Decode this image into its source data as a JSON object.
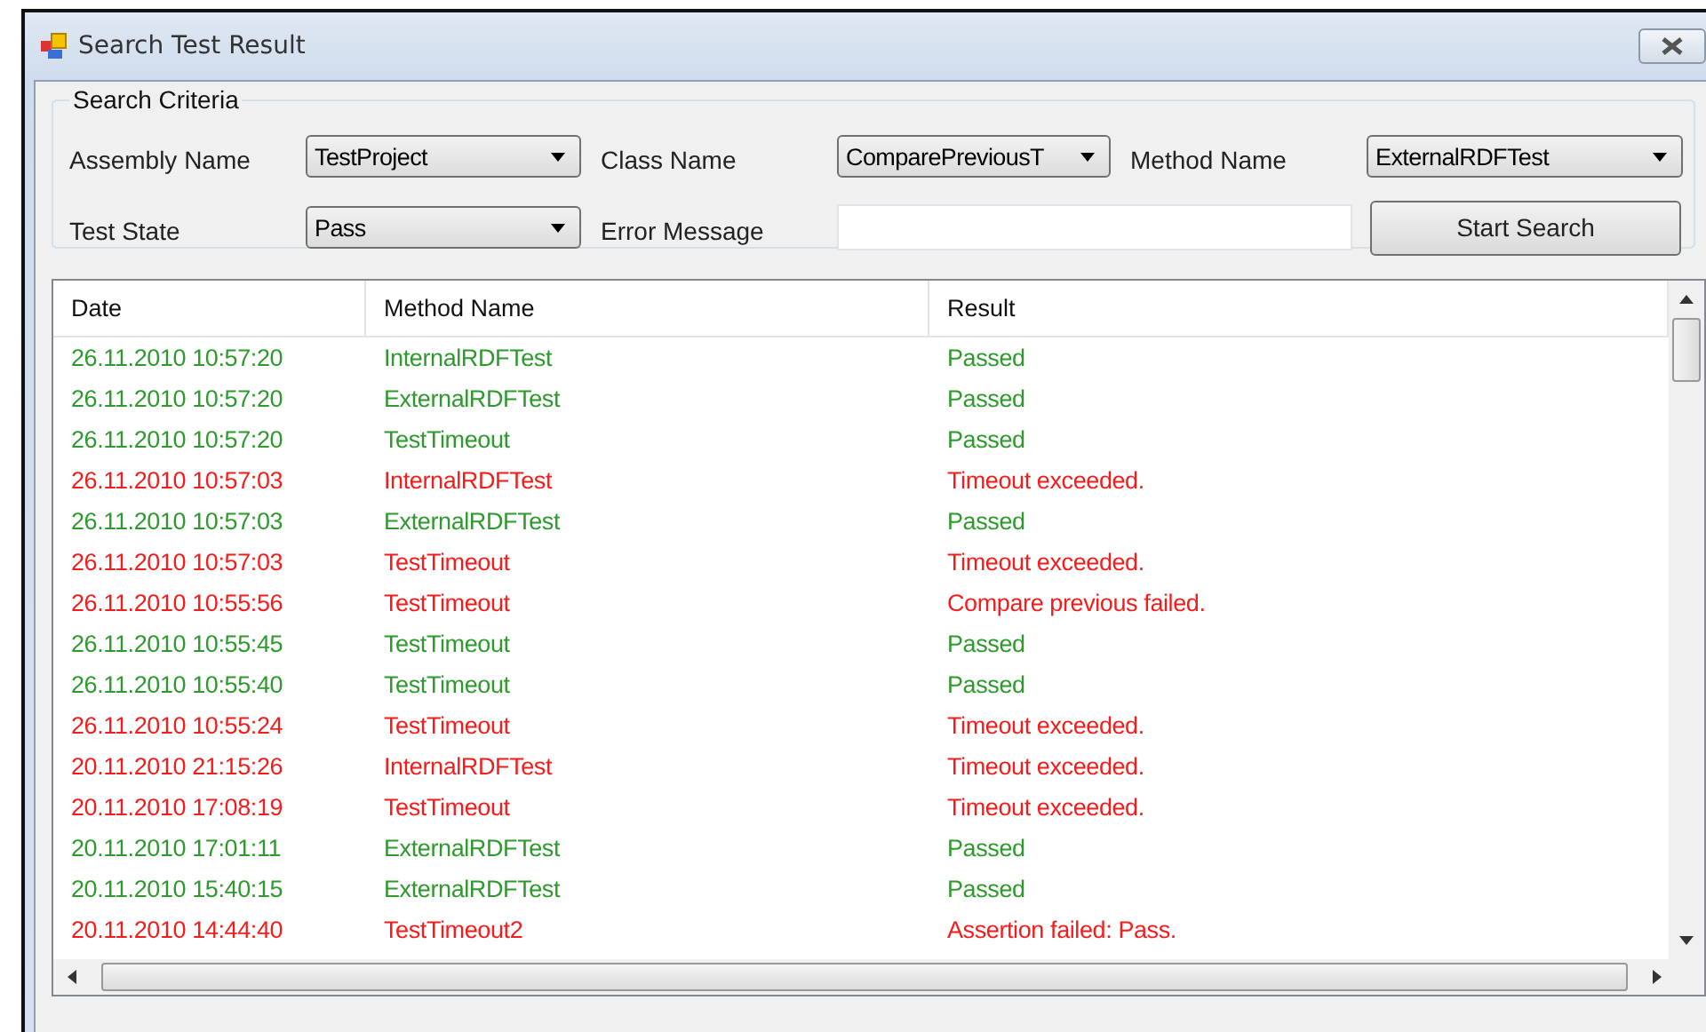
{
  "window": {
    "title": "Search Test Result"
  },
  "search_criteria": {
    "title": "Search Criteria",
    "assembly_name": {
      "label": "Assembly Name",
      "value": "TestProject"
    },
    "class_name": {
      "label": "Class Name",
      "value": "ComparePreviousT"
    },
    "method_name": {
      "label": "Method Name",
      "value": "ExternalRDFTest"
    },
    "test_state": {
      "label": "Test State",
      "value": "Pass"
    },
    "error_message": {
      "label": "Error Message"
    },
    "start_button": "Start Search"
  },
  "table": {
    "columns": [
      "Date",
      "Method Name",
      "Result"
    ],
    "rows": [
      {
        "date": "26.11.2010 10:57:20",
        "method": "InternalRDFTest",
        "result": "Passed",
        "passed": true
      },
      {
        "date": "26.11.2010 10:57:20",
        "method": "ExternalRDFTest",
        "result": "Passed",
        "passed": true
      },
      {
        "date": "26.11.2010 10:57:20",
        "method": "TestTimeout",
        "result": "Passed",
        "passed": true
      },
      {
        "date": "26.11.2010 10:57:03",
        "method": "InternalRDFTest",
        "result": "Timeout exceeded.",
        "passed": false
      },
      {
        "date": "26.11.2010 10:57:03",
        "method": "ExternalRDFTest",
        "result": "Passed",
        "passed": true
      },
      {
        "date": "26.11.2010 10:57:03",
        "method": "TestTimeout",
        "result": "Timeout exceeded.",
        "passed": false
      },
      {
        "date": "26.11.2010 10:55:56",
        "method": "TestTimeout",
        "result": "Compare previous failed.",
        "passed": false
      },
      {
        "date": "26.11.2010 10:55:45",
        "method": "TestTimeout",
        "result": "Passed",
        "passed": true
      },
      {
        "date": "26.11.2010 10:55:40",
        "method": "TestTimeout",
        "result": "Passed",
        "passed": true
      },
      {
        "date": "26.11.2010 10:55:24",
        "method": "TestTimeout",
        "result": "Timeout exceeded.",
        "passed": false
      },
      {
        "date": "20.11.2010 21:15:26",
        "method": "InternalRDFTest",
        "result": "Timeout exceeded.",
        "passed": false
      },
      {
        "date": "20.11.2010 17:08:19",
        "method": "TestTimeout",
        "result": "Timeout exceeded.",
        "passed": false
      },
      {
        "date": "20.11.2010 17:01:11",
        "method": "ExternalRDFTest",
        "result": "Passed",
        "passed": true
      },
      {
        "date": "20.11.2010 15:40:15",
        "method": "ExternalRDFTest",
        "result": "Passed",
        "passed": true
      },
      {
        "date": "20.11.2010 14:44:40",
        "method": "TestTimeout2",
        "result": "Assertion failed: Pass.",
        "passed": false
      }
    ]
  }
}
